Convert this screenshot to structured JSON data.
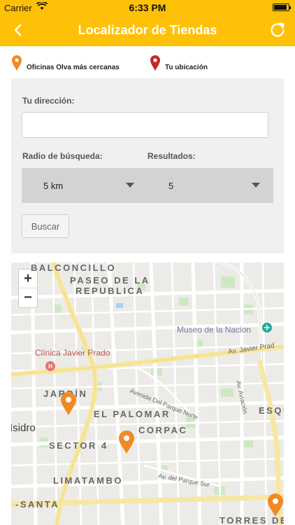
{
  "status": {
    "carrier": "Carrier",
    "time": "6:33 PM"
  },
  "nav": {
    "title": "Localizador de Tiendas",
    "back_icon": "chevron-left-icon",
    "refresh_icon": "refresh-icon"
  },
  "legend": {
    "offices": "Oficinas Olva más cercanas",
    "location": "Tu ubicación",
    "offices_color": "#f08a24",
    "location_color": "#c62828"
  },
  "form": {
    "address_label": "Tu dirección:",
    "address_value": "",
    "radius_label": "Radio de búsqueda:",
    "radius_value": "5 km",
    "results_label": "Resultados:",
    "results_value": "5",
    "search_button": "Buscar"
  },
  "map": {
    "zoom_in": "+",
    "zoom_out": "−",
    "labels": {
      "balconcillo": "BALCONCILLO",
      "paseo1": "PASEO DE LA",
      "paseo2": "REPUBLICA",
      "museo": "Museo de la Nacion",
      "clinica": "Clínica Javier Prado",
      "javier_prado": "Av. Javier Prad",
      "aviacion": "Av. Aviación",
      "parque_norte": "Avenida Del Parque Norte",
      "jardin": "JARDÍN",
      "palomar": "EL PALOMAR",
      "esqu": "ESQU",
      "isidro": "Isidro",
      "corpac": "CORPAC",
      "sector4": "SECTOR 4",
      "limatambo": "LIMATAMBO",
      "parque_sur": "Av. del Parque Sur",
      "santa": "-SANTA",
      "torres": "TORRES DE"
    }
  }
}
